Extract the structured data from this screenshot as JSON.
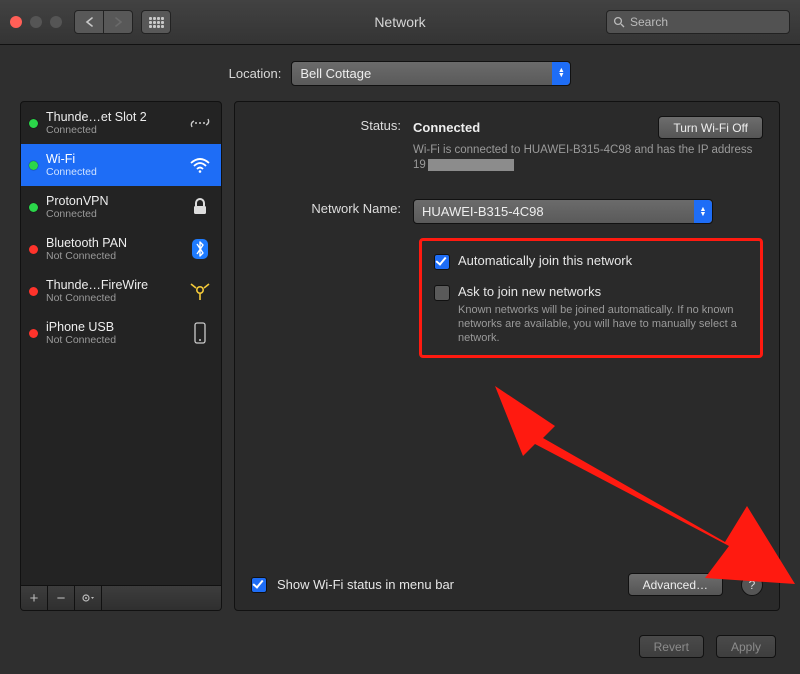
{
  "window": {
    "title": "Network",
    "search_placeholder": "Search"
  },
  "location": {
    "label": "Location:",
    "value": "Bell Cottage"
  },
  "sidebar": {
    "items": [
      {
        "name": "Thunde…et Slot 2",
        "status": "Connected",
        "color": "green",
        "icon": "thunderbolt-bridge"
      },
      {
        "name": "Wi-Fi",
        "status": "Connected",
        "color": "green",
        "icon": "wifi",
        "selected": true
      },
      {
        "name": "ProtonVPN",
        "status": "Connected",
        "color": "green",
        "icon": "vpn-lock"
      },
      {
        "name": "Bluetooth PAN",
        "status": "Not Connected",
        "color": "red",
        "icon": "bluetooth"
      },
      {
        "name": "Thunde…FireWire",
        "status": "Not Connected",
        "color": "red",
        "icon": "firewire"
      },
      {
        "name": "iPhone USB",
        "status": "Not Connected",
        "color": "red",
        "icon": "iphone"
      }
    ]
  },
  "main": {
    "status_label": "Status:",
    "status_value": "Connected",
    "wifi_off_btn": "Turn Wi-Fi Off",
    "status_desc_1": "Wi-Fi is connected to HUAWEI-B315-4C98 and has the IP address 19",
    "network_name_label": "Network Name:",
    "network_name_value": "HUAWEI-B315-4C98",
    "auto_join": "Automatically join this network",
    "ask_join": "Ask to join new networks",
    "ask_join_desc": "Known networks will be joined automatically. If no known networks are available, you will have to manually select a network.",
    "show_status": "Show Wi-Fi status in menu bar",
    "advanced_btn": "Advanced…"
  },
  "footer": {
    "revert": "Revert",
    "apply": "Apply"
  }
}
